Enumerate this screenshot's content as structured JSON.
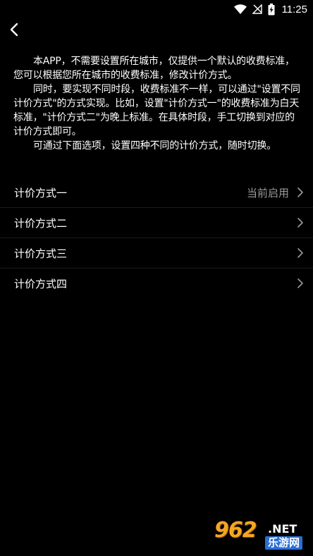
{
  "status_bar": {
    "time": "11:25",
    "icons": [
      "wifi-icon",
      "no-signal-icon",
      "battery-charging-icon"
    ]
  },
  "nav": {
    "back_icon": "chevron-left-icon"
  },
  "description": {
    "paragraphs": [
      "本APP，不需要设置所在城市，仅提供一个默认的收费标准，您可以根据您所在城市的收费标准，修改计价方式。",
      "同时，要实现不同时段，收费标准不一样，可以通过\"设置不同计价方式\"的方式实现。比如，设置\"计价方式一\"的收费标准为白天标准，\"计价方式二\"为晚上标准。在具体时段，手工切换到对应的计价方式即可。",
      "可通过下面选项，设置四种不同的计价方式，随时切换。"
    ]
  },
  "options": [
    {
      "label": "计价方式一",
      "status": "当前启用"
    },
    {
      "label": "计价方式二",
      "status": ""
    },
    {
      "label": "计价方式三",
      "status": ""
    },
    {
      "label": "计价方式四",
      "status": ""
    }
  ],
  "watermark": {
    "number": "962",
    "suffix": ".NET",
    "name": "乐游网"
  },
  "colors": {
    "background": "#000000",
    "text": "#ffffff",
    "secondary_text": "#9a9a9a",
    "divider": "#1a1a1a"
  }
}
